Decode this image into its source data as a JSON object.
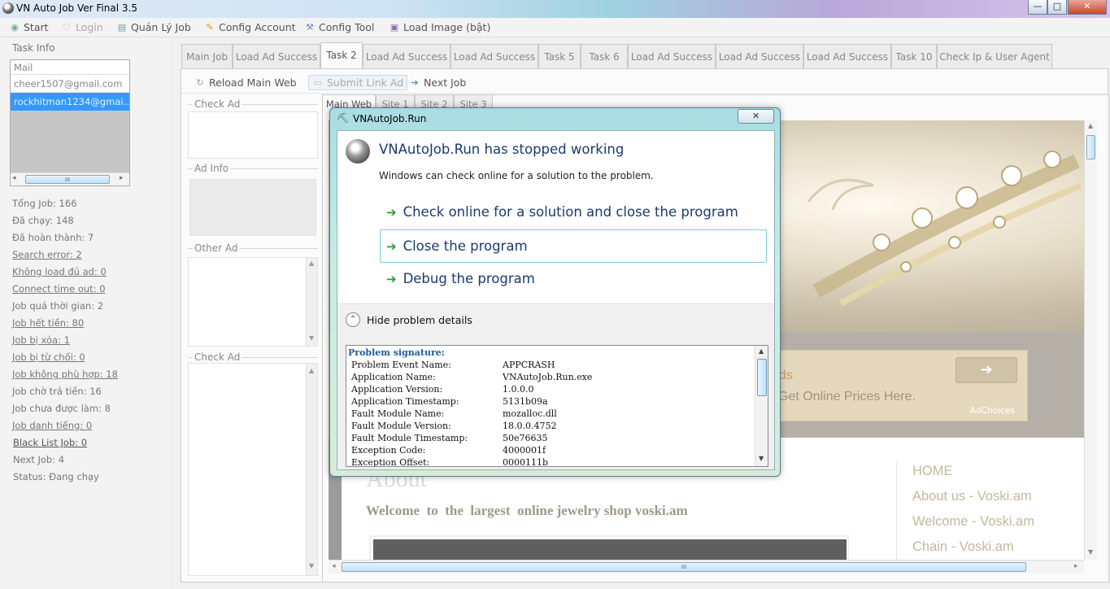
{
  "window": {
    "title": "VN Auto Job Ver Final 3.5",
    "min": "—",
    "max": "□",
    "close": "✕"
  },
  "toolbar": {
    "start": "Start",
    "login": "Login",
    "quan_ly_job": "Quản Lý Job",
    "config_account": "Config Account",
    "config_tool": "Config Tool",
    "load_image": "Load Image (bật)"
  },
  "task_info": {
    "label": "Task Info",
    "mail_header": "Mail",
    "mails": [
      "cheer1507@gmail.com",
      "rockhitman1234@gmai..."
    ],
    "scroll_mark": "III"
  },
  "stats": [
    "Tổng Job: 166",
    "Đã chạy: 148",
    "Đã hoàn thành: 7",
    "Search error: 2",
    "Không load đủ ad: 0",
    "Connect time out: 0",
    "Job quá thời gian: 2",
    "Job hết tiền: 80",
    "Job bị xóa: 1",
    "Job bị từ chối: 0",
    "Job không phù hợp: 18",
    "Job chờ trả tiền: 16",
    "Job chưa được làm: 8",
    "Job danh tiếng: 0",
    "Black List Job: 0",
    "Next Job: 4",
    "Status: Đang chạy"
  ],
  "tabs": [
    "Main Job",
    "Load Ad Success",
    "Task 2",
    "Load Ad Success",
    "Load Ad Success",
    "Task 5",
    "Task 6",
    "Load Ad Success",
    "Load Ad Success",
    "Load Ad Success",
    "Task 10",
    "Check Ip & User Agent"
  ],
  "subtoolbar": {
    "reload": "Reload Main Web",
    "submit": "Submit Link Ad",
    "next": "Next Job"
  },
  "groups": {
    "check_ad": "Check Ad",
    "ad_info": "Ad Info",
    "other_ad": "Other Ad",
    "check_ad_2": "Check Ad"
  },
  "subtabs": [
    "Main Web",
    "Site 1",
    "Site 2",
    "Site 3"
  ],
  "webpage": {
    "ad_text_1": "nds",
    "ad_text_2": "Get Online Prices Here.",
    "adchoices": "AdChoices",
    "about": "About",
    "welcome": "Welcome  to  the  largest  online jewelry shop voski.am",
    "menu": [
      "HOME",
      "About us - Voski.am",
      "Welcome - Voski.am",
      "Chain - Voski.am"
    ],
    "scroll_mark": "III"
  },
  "dialog": {
    "title": "VNAutoJob.Run",
    "close": "✕",
    "heading": "VNAutoJob.Run has stopped working",
    "subtext": "Windows can check online for a solution to the problem.",
    "options": [
      "Check online for a solution and close the program",
      "Close the program",
      "Debug the program"
    ],
    "hide_details": "Hide problem details",
    "signature_title": "Problem signature:",
    "signature": [
      {
        "k": "Problem Event Name:",
        "v": "APPCRASH"
      },
      {
        "k": "Application Name:",
        "v": "VNAutoJob.Run.exe"
      },
      {
        "k": "Application Version:",
        "v": "1.0.0.0"
      },
      {
        "k": "Application Timestamp:",
        "v": "5131b09a"
      },
      {
        "k": "Fault Module Name:",
        "v": "mozalloc.dll"
      },
      {
        "k": "Fault Module Version:",
        "v": "18.0.0.4752"
      },
      {
        "k": "Fault Module Timestamp:",
        "v": "50e76635"
      },
      {
        "k": "Exception Code:",
        "v": "4000001f"
      },
      {
        "k": "Exception Offset:",
        "v": "0000111b"
      }
    ]
  },
  "colors": {
    "accent_blue": "#1a3a6e",
    "selected_mail": "#3399ff",
    "dialog_frame": "#a8dde2"
  }
}
